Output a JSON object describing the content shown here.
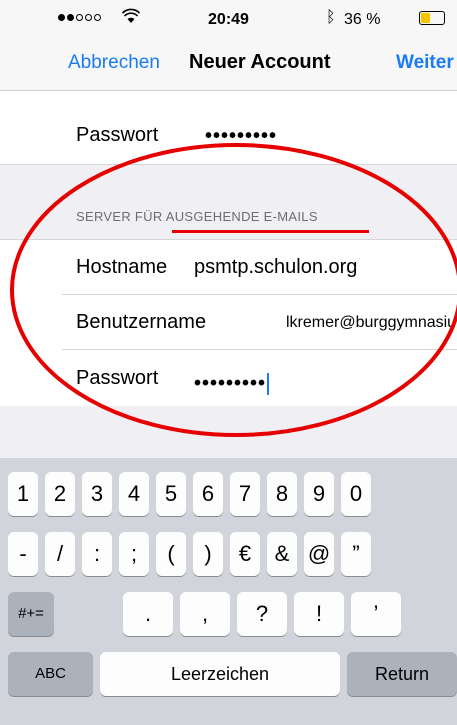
{
  "status_bar": {
    "time": "20:49",
    "battery_percent": "36 %",
    "signal_bars_filled": 2,
    "signal_bars_total": 5,
    "battery_level": 0.36
  },
  "nav": {
    "cancel_label": "Abbrechen",
    "title": "Neuer Account",
    "next_label": "Weiter"
  },
  "incoming": {
    "password_label": "Passwort",
    "password_mask": "•••••••••"
  },
  "outgoing": {
    "section_header": "SERVER FÜR AUSGEHENDE E-MAILS",
    "hostname_label": "Hostname",
    "hostname_value": "psmtp.schulon.org",
    "username_label": "Benutzername",
    "username_value": "lkremer@burggymnasiu...",
    "password_label": "Passwort",
    "password_mask": "•••••••••"
  },
  "keyboard": {
    "row1": [
      "1",
      "2",
      "3",
      "4",
      "5",
      "6",
      "7",
      "8",
      "9",
      "0"
    ],
    "row2": [
      "-",
      "/",
      ":",
      ";",
      "(",
      ")",
      "€",
      "&",
      "@",
      "”"
    ],
    "shift_label": "#+=",
    "row3": [
      ".",
      ",",
      "?",
      "!",
      "’"
    ],
    "abc_label": "ABC",
    "space_label": "Leerzeichen",
    "return_label": "Return"
  },
  "colors": {
    "accent": "#1a7cf5",
    "annotation": "#e60000"
  }
}
